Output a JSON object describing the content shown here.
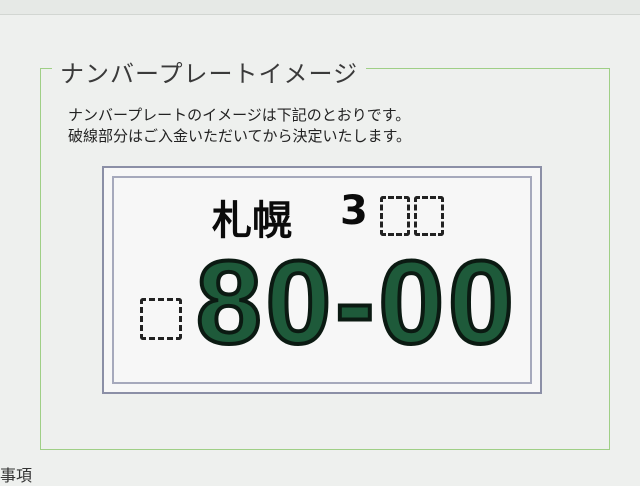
{
  "section": {
    "legend": "ナンバープレートイメージ",
    "description_line1": "ナンバープレートのイメージは下記のとおりです。",
    "description_line2": "破線部分はご入金いただいてから決定いたします。"
  },
  "plate": {
    "region": "札幌",
    "class_number": "3",
    "number": "80-00",
    "number_color": "#1e5a3a"
  },
  "footer": {
    "partial_text": "事項"
  }
}
